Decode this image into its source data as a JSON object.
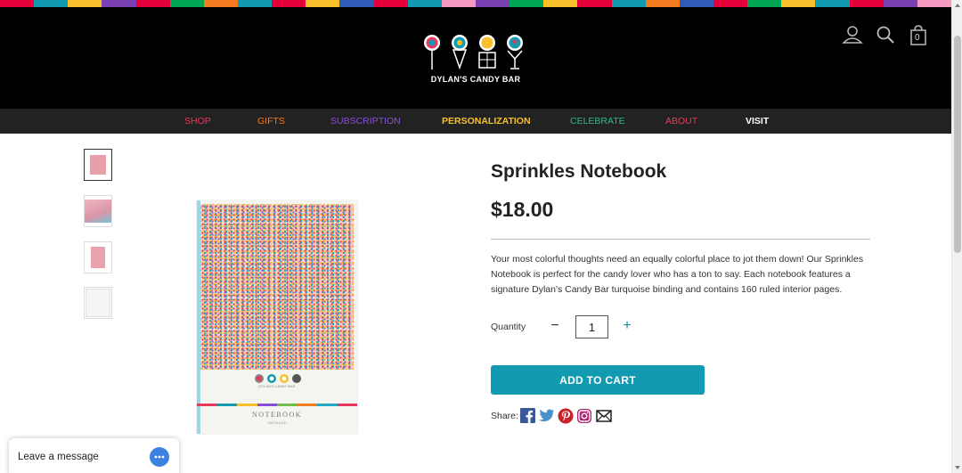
{
  "stripe_colors": [
    "#e4003a",
    "#129bb0",
    "#f8c02b",
    "#7a3fb1",
    "#e4003a",
    "#00a651",
    "#f47b20",
    "#129bb0",
    "#e4003a",
    "#f8c02b",
    "#2e5cb8",
    "#e4003a",
    "#129bb0",
    "#f59ac0",
    "#7a3fb1",
    "#00a651",
    "#f8c02b",
    "#e4003a",
    "#129bb0",
    "#f47b20",
    "#2e5cb8",
    "#e4003a",
    "#00a651",
    "#f8c02b",
    "#129bb0",
    "#e4003a",
    "#7a3fb1",
    "#f59ac0"
  ],
  "brand": {
    "name": "DYLAN'S CANDY BAR"
  },
  "header": {
    "cart_count": "0"
  },
  "nav": {
    "items": [
      {
        "label": "SHOP",
        "color": "#e8385e"
      },
      {
        "label": "GIFTS",
        "color": "#f47b20"
      },
      {
        "label": "SUBSCRIPTION",
        "color": "#8a4fd8"
      },
      {
        "label": "PERSONALIZATION",
        "color": "#f8c02b"
      },
      {
        "label": "CELEBRATE",
        "color": "#2fb88a"
      },
      {
        "label": "ABOUT",
        "color": "#e8385e"
      },
      {
        "label": "VISIT",
        "color": "#ffffff"
      }
    ]
  },
  "product": {
    "title": "Sprinkles Notebook",
    "price": "$18.00",
    "description": "Your most colorful thoughts need an equally colorful place to jot them down! Our Sprinkles Notebook is perfect for the candy lover who has a ton to say. Each notebook features a signature Dylan's Candy Bar turquoise binding and contains 160 ruled interior pages.",
    "image_label": "NOTEBOOK",
    "image_sublabel": "160 RULED",
    "image_brand": "DYLAN'S CANDY BAR"
  },
  "quantity": {
    "label": "Quantity",
    "value": "1",
    "minus": "−",
    "plus": "+"
  },
  "add_to_cart": "ADD TO CART",
  "share": {
    "label": "Share:"
  },
  "chat": {
    "label": "Leave a message"
  },
  "colors": {
    "accent": "#129bb0",
    "header_bg": "#000000",
    "nav_bg": "#222222"
  }
}
